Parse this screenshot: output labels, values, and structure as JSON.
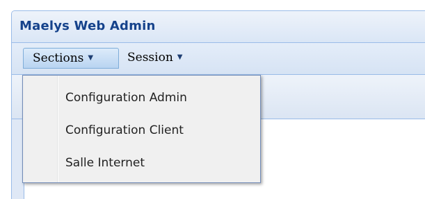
{
  "window": {
    "title": "Maelys Web Admin"
  },
  "menubar": {
    "sections_label": "Sections",
    "session_label": "Session",
    "caret_glyph": "▼"
  },
  "dropdown": {
    "items": [
      {
        "label": "Configuration Admin"
      },
      {
        "label": "Configuration Client"
      },
      {
        "label": "Salle Internet"
      }
    ]
  },
  "colors": {
    "title_text": "#15428b",
    "panel_border": "#99bbe8",
    "menu_bg": "#f0f0f0",
    "active_button": "#b9d4f1"
  }
}
